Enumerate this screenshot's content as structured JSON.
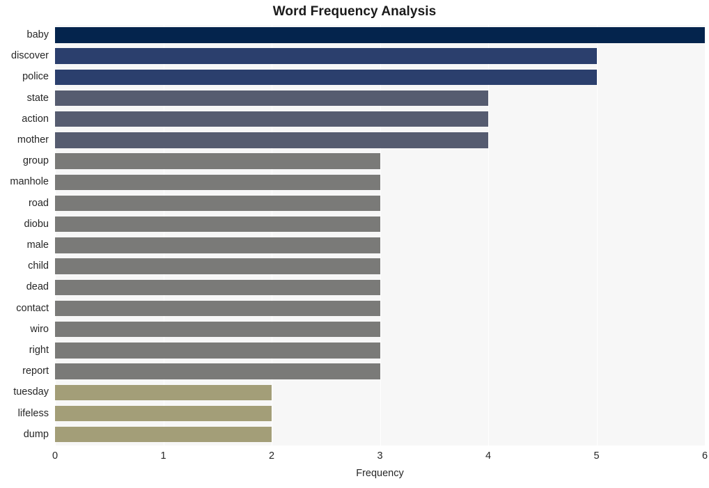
{
  "chart_data": {
    "type": "bar",
    "orientation": "horizontal",
    "title": "Word Frequency Analysis",
    "xlabel": "Frequency",
    "ylabel": "",
    "xlim": [
      0,
      6
    ],
    "xticks": [
      0,
      1,
      2,
      3,
      4,
      5,
      6
    ],
    "xtick_labels": [
      "0",
      "1",
      "2",
      "3",
      "4",
      "5",
      "6"
    ],
    "grid": true,
    "grid_axis": "x",
    "legend": false,
    "plot_background": "#f7f7f7",
    "gridline_color": "#ffffff",
    "categories": [
      "baby",
      "discover",
      "police",
      "state",
      "action",
      "mother",
      "group",
      "manhole",
      "road",
      "diobu",
      "male",
      "child",
      "dead",
      "contact",
      "wiro",
      "right",
      "report",
      "tuesday",
      "lifeless",
      "dump"
    ],
    "values": [
      6,
      5,
      5,
      4,
      4,
      4,
      3,
      3,
      3,
      3,
      3,
      3,
      3,
      3,
      3,
      3,
      3,
      2,
      2,
      2
    ],
    "bar_colors": [
      "#04244d",
      "#2b3f6d",
      "#2b3f6d",
      "#565c70",
      "#565c70",
      "#565c70",
      "#7a7a78",
      "#7a7a78",
      "#7a7a78",
      "#7a7a78",
      "#7a7a78",
      "#7a7a78",
      "#7a7a78",
      "#7a7a78",
      "#7a7a78",
      "#7a7a78",
      "#7a7a78",
      "#a39e78",
      "#a39e78",
      "#a39e78"
    ]
  }
}
